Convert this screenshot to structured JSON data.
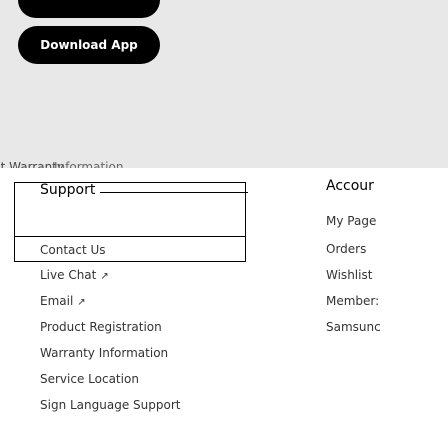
{
  "header": {
    "download_label": "Download App"
  },
  "fragments": {
    "left": "ct Warranty",
    "right": "Information"
  },
  "support": {
    "title": "Support",
    "items": [
      {
        "label": "Contact Us",
        "external": false
      },
      {
        "label": "Live Chat",
        "external": true
      },
      {
        "label": "Email",
        "external": true
      },
      {
        "label": "Product Registration",
        "external": false
      },
      {
        "label": "Warranty Information",
        "external": false
      },
      {
        "label": "Service Location",
        "external": false
      },
      {
        "label": "Sign Language Support",
        "external": false
      }
    ]
  },
  "account": {
    "title": "Accour",
    "items": [
      "My Page",
      "Orders",
      "Wishlist",
      "Member:",
      "Samsunc"
    ]
  },
  "icons": {
    "external_link": "external-link-icon"
  }
}
